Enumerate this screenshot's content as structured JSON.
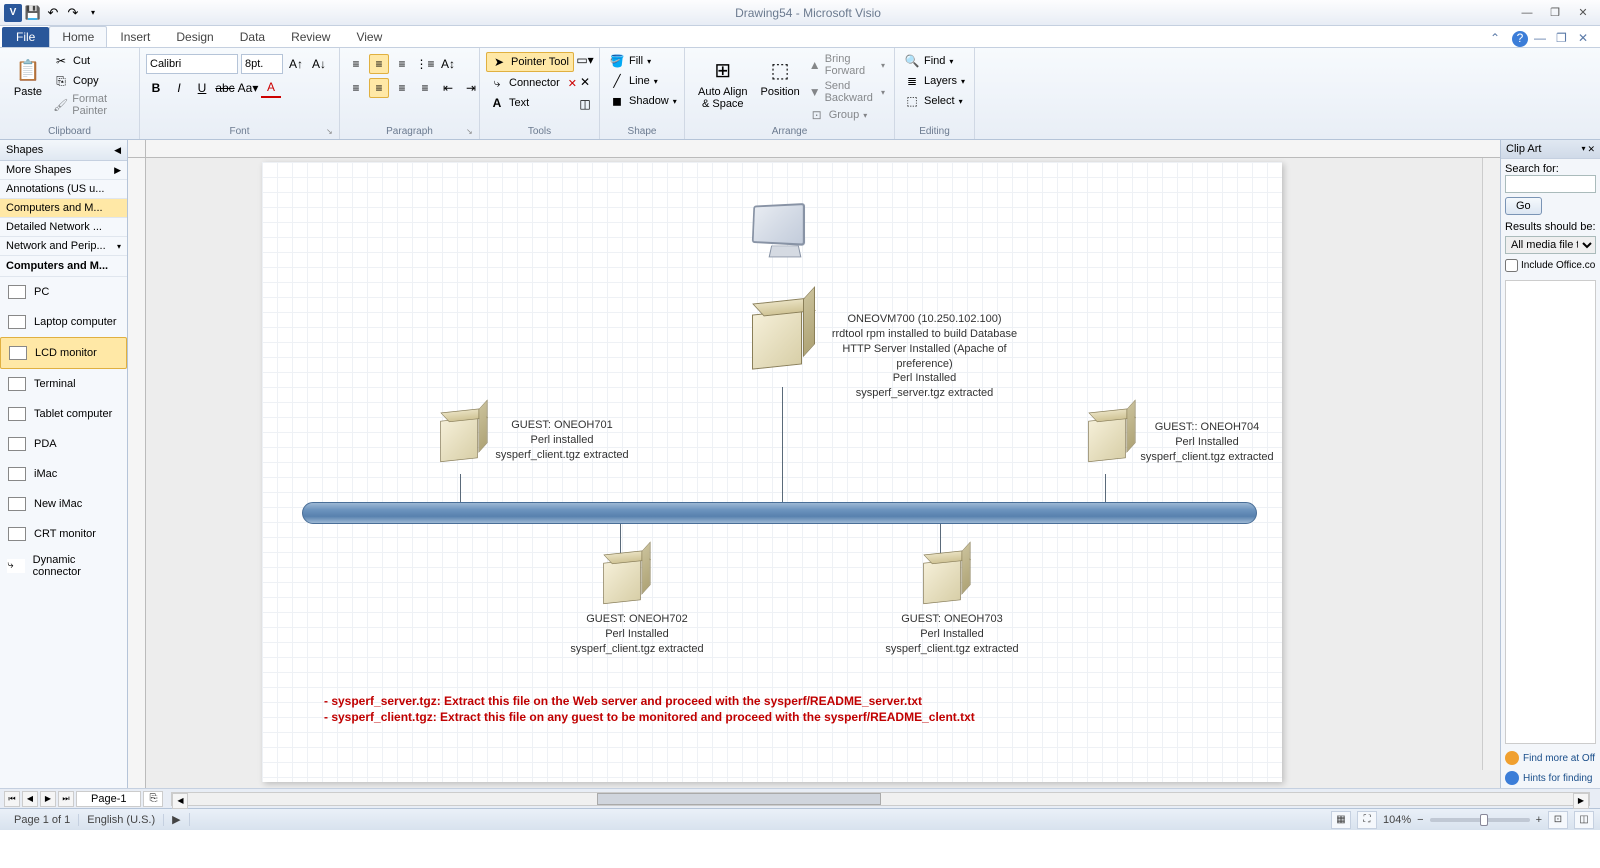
{
  "title": "Drawing54 - Microsoft Visio",
  "tabs": {
    "file": "File",
    "home": "Home",
    "insert": "Insert",
    "design": "Design",
    "data": "Data",
    "review": "Review",
    "view": "View"
  },
  "clipboard": {
    "label": "Clipboard",
    "paste": "Paste",
    "cut": "Cut",
    "copy": "Copy",
    "format_painter": "Format Painter"
  },
  "font": {
    "label": "Font",
    "family": "Calibri",
    "size": "8pt."
  },
  "paragraph": {
    "label": "Paragraph"
  },
  "tools": {
    "label": "Tools",
    "pointer": "Pointer Tool",
    "connector": "Connector",
    "text": "Text"
  },
  "shape_group": {
    "label": "Shape",
    "fill": "Fill",
    "line": "Line",
    "shadow": "Shadow"
  },
  "arrange": {
    "label": "Arrange",
    "autoalign": "Auto Align & Space",
    "position": "Position",
    "bring_forward": "Bring Forward",
    "send_backward": "Send Backward",
    "group": "Group"
  },
  "editing": {
    "label": "Editing",
    "find": "Find",
    "layers": "Layers",
    "select": "Select"
  },
  "shapes": {
    "title": "Shapes",
    "more": "More Shapes",
    "cats": [
      "Annotations (US u...",
      "Computers and M...",
      "Detailed Network ...",
      "Network and Perip..."
    ],
    "stencil": "Computers and M...",
    "items": [
      "PC",
      "Laptop computer",
      "LCD monitor",
      "Terminal",
      "Tablet computer",
      "PDA",
      "iMac",
      "New iMac",
      "CRT monitor",
      "Dynamic connector"
    ]
  },
  "diagram": {
    "server_main": "ONEOVM700 (10.250.102.100)\nrrdtool rpm installed to build Database\nHTTP Server Installed (Apache of preference)\nPerl Installed\nsysperf_server.tgz extracted",
    "guest1": "GUEST: ONEOH701\nPerl installed\nsysperf_client.tgz extracted",
    "guest4": "GUEST:: ONEOH704\nPerl Installed\nsysperf_client.tgz extracted",
    "guest2": "GUEST: ONEOH702\nPerl Installed\nsysperf_client.tgz extracted",
    "guest3": "GUEST: ONEOH703\nPerl Installed\nsysperf_client.tgz extracted",
    "note1": "- sysperf_server.tgz: Extract this file on the Web server and proceed with the sysperf/README_server.txt",
    "note2": "- sysperf_client.tgz: Extract this file on any guest to be monitored and proceed with the   sysperf/README_clent.txt"
  },
  "page_tab": "Page-1",
  "clipart": {
    "title": "Clip Art",
    "search_for": "Search for:",
    "go": "Go",
    "results_be": "Results should be:",
    "media_types": "All media file t",
    "include": "Include Office.co",
    "find_more": "Find more at Off",
    "hints": "Hints for finding"
  },
  "status": {
    "page": "Page 1 of 1",
    "lang": "English (U.S.)",
    "zoom": "104%"
  }
}
